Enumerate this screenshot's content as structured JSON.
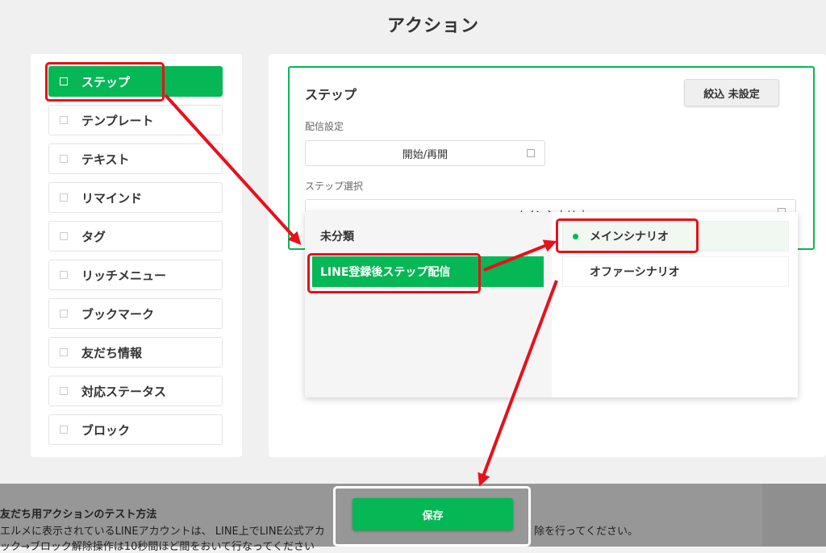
{
  "modal": {
    "title": "アクション"
  },
  "actions": [
    {
      "label": "ステップ",
      "active": true
    },
    {
      "label": "テンプレート",
      "active": false
    },
    {
      "label": "テキスト",
      "active": false
    },
    {
      "label": "リマインド",
      "active": false
    },
    {
      "label": "タグ",
      "active": false
    },
    {
      "label": "リッチメニュー",
      "active": false
    },
    {
      "label": "ブックマーク",
      "active": false
    },
    {
      "label": "友だち情報",
      "active": false
    },
    {
      "label": "対応ステータス",
      "active": false
    },
    {
      "label": "ブロック",
      "active": false
    }
  ],
  "step_panel": {
    "title": "ステップ",
    "filter_button": "絞込 未設定",
    "delivery_label": "配信設定",
    "delivery_value": "開始/再開",
    "step_select_label": "ステップ選択",
    "step_select_value": "メインシナリオ"
  },
  "dropdown": {
    "categories": [
      {
        "label": "未分類",
        "active": false
      },
      {
        "label": "LINE登録後ステップ配信",
        "active": true
      }
    ],
    "scenarios": [
      {
        "label": "メインシナリオ",
        "selected": true
      },
      {
        "label": "オファーシナリオ",
        "selected": false
      }
    ]
  },
  "bottom": {
    "heading": "友だち用アクションのテスト方法",
    "line1": "エルメに表示されているLINEアカウントは、 LINE上でLINE公式アカ",
    "line1_end": "除を行ってください。",
    "line2": "ック→ブロック解除操作は10秒間ほど間をおいて行なってください"
  },
  "save_button": "保存",
  "colors": {
    "accent": "#06b755",
    "highlight": "#e8101b"
  }
}
